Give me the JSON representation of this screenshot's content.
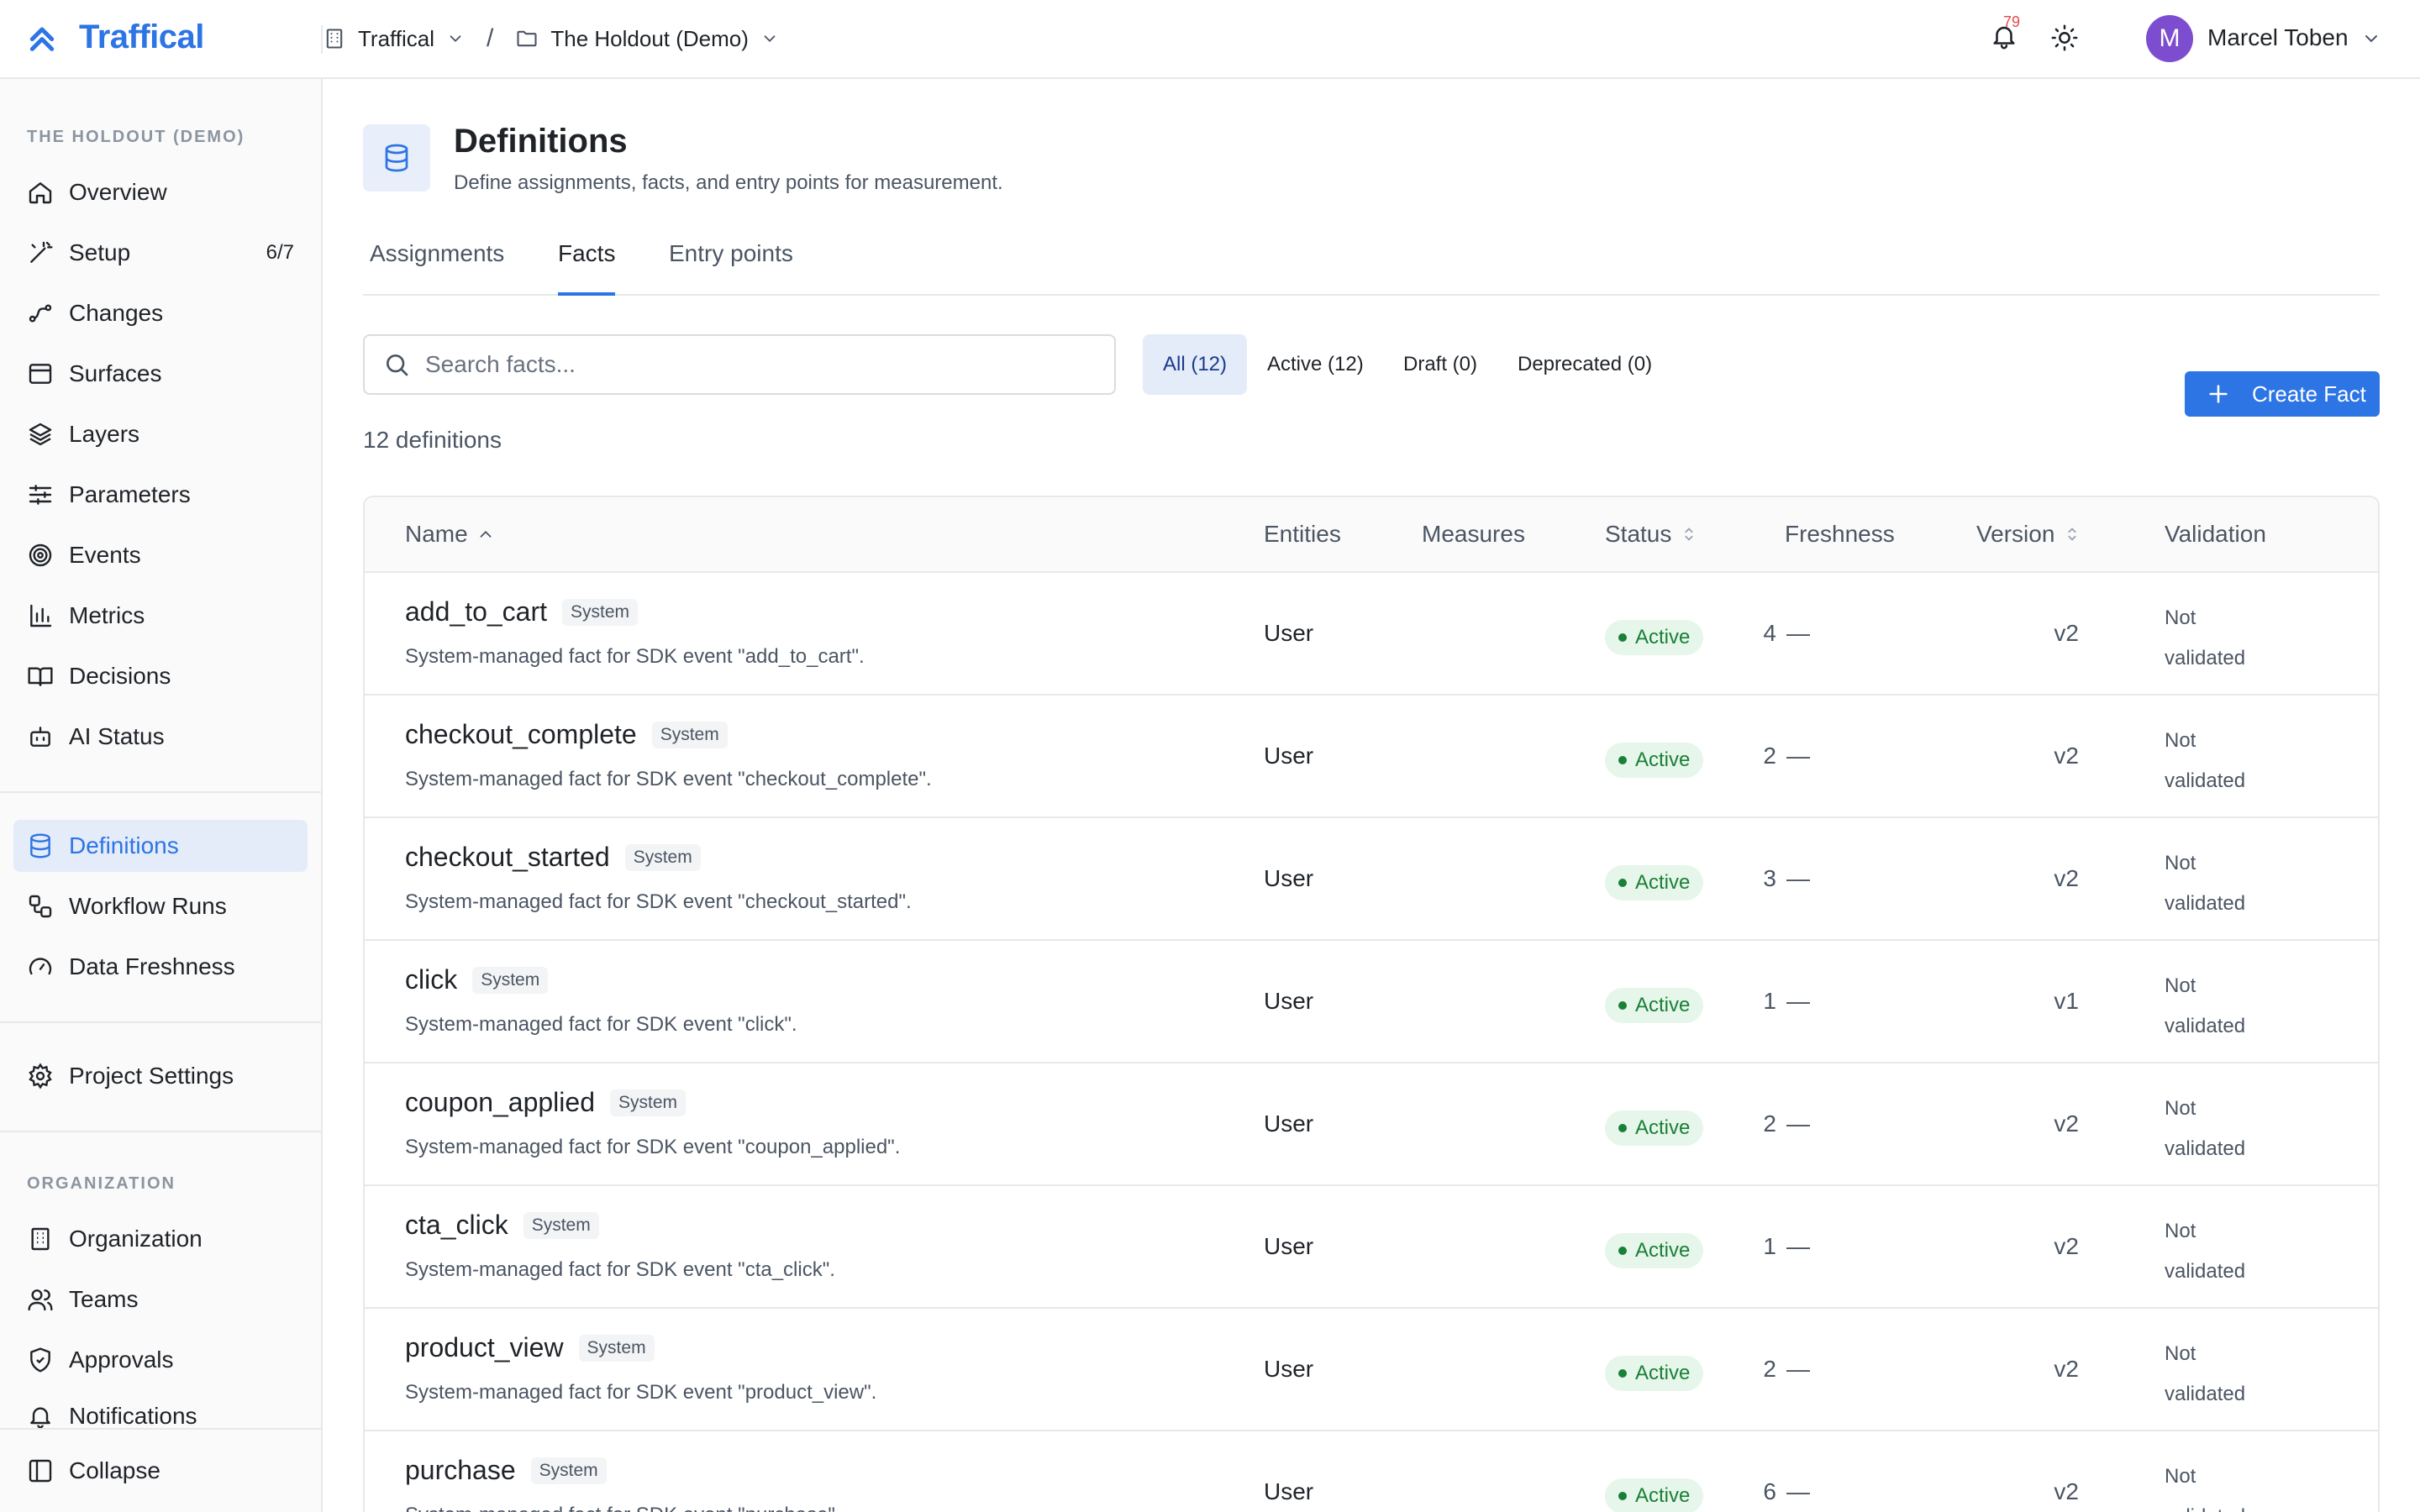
{
  "app": {
    "brand": "Traffical"
  },
  "breadcrumb": {
    "org": "Traffical",
    "separator": "/",
    "project": "The Holdout (Demo)"
  },
  "header": {
    "notification_count": "79",
    "user_initial": "M",
    "user_name": "Marcel Toben"
  },
  "sidebar": {
    "project_section_label": "THE HOLDOUT (DEMO)",
    "items": [
      {
        "label": "Overview",
        "icon": "home-icon"
      },
      {
        "label": "Setup",
        "icon": "wand-icon",
        "count": "6/7"
      },
      {
        "label": "Changes",
        "icon": "waypoints-icon"
      },
      {
        "label": "Surfaces",
        "icon": "browser-icon"
      },
      {
        "label": "Layers",
        "icon": "layers-icon"
      },
      {
        "label": "Parameters",
        "icon": "sliders-icon"
      },
      {
        "label": "Events",
        "icon": "target-icon"
      },
      {
        "label": "Metrics",
        "icon": "bar-chart-icon"
      },
      {
        "label": "Decisions",
        "icon": "book-icon"
      },
      {
        "label": "AI Status",
        "icon": "bot-icon"
      }
    ],
    "definitions_items": [
      {
        "label": "Definitions",
        "icon": "database-icon",
        "active": true
      },
      {
        "label": "Workflow Runs",
        "icon": "workflow-icon"
      },
      {
        "label": "Data Freshness",
        "icon": "gauge-icon"
      }
    ],
    "settings_items": [
      {
        "label": "Project Settings",
        "icon": "gear-icon"
      }
    ],
    "org_section_label": "ORGANIZATION",
    "org_items": [
      {
        "label": "Organization",
        "icon": "building-icon"
      },
      {
        "label": "Teams",
        "icon": "users-icon"
      },
      {
        "label": "Approvals",
        "icon": "shield-check-icon"
      },
      {
        "label": "Notifications",
        "icon": "bell-icon"
      }
    ],
    "collapse_label": "Collapse"
  },
  "page": {
    "title": "Definitions",
    "subtitle": "Define assignments, facts, and entry points for measurement.",
    "tabs": [
      {
        "label": "Assignments"
      },
      {
        "label": "Facts",
        "active": true
      },
      {
        "label": "Entry points"
      }
    ],
    "search_placeholder": "Search facts...",
    "filters": [
      {
        "label": "All (12)",
        "active": true
      },
      {
        "label": "Active (12)"
      },
      {
        "label": "Draft (0)"
      },
      {
        "label": "Deprecated (0)"
      }
    ],
    "create_label": "Create Fact",
    "count_text": "12 definitions"
  },
  "table": {
    "columns": [
      "Name",
      "Entities",
      "Measures",
      "Status",
      "Freshness",
      "Version",
      "Validation"
    ],
    "rows": [
      {
        "name": "add_to_cart",
        "badge": "System",
        "desc": "System-managed fact for SDK event \"add_to_cart\".",
        "entities": "User",
        "measures": "4",
        "status": "Active",
        "freshness": "—",
        "version": "v2",
        "validation_1": "Not",
        "validation_2": "validated"
      },
      {
        "name": "checkout_complete",
        "badge": "System",
        "desc": "System-managed fact for SDK event \"checkout_complete\".",
        "entities": "User",
        "measures": "2",
        "status": "Active",
        "freshness": "—",
        "version": "v2",
        "validation_1": "Not",
        "validation_2": "validated"
      },
      {
        "name": "checkout_started",
        "badge": "System",
        "desc": "System-managed fact for SDK event \"checkout_started\".",
        "entities": "User",
        "measures": "3",
        "status": "Active",
        "freshness": "—",
        "version": "v2",
        "validation_1": "Not",
        "validation_2": "validated"
      },
      {
        "name": "click",
        "badge": "System",
        "desc": "System-managed fact for SDK event \"click\".",
        "entities": "User",
        "measures": "1",
        "status": "Active",
        "freshness": "—",
        "version": "v1",
        "validation_1": "Not",
        "validation_2": "validated"
      },
      {
        "name": "coupon_applied",
        "badge": "System",
        "desc": "System-managed fact for SDK event \"coupon_applied\".",
        "entities": "User",
        "measures": "2",
        "status": "Active",
        "freshness": "—",
        "version": "v2",
        "validation_1": "Not",
        "validation_2": "validated"
      },
      {
        "name": "cta_click",
        "badge": "System",
        "desc": "System-managed fact for SDK event \"cta_click\".",
        "entities": "User",
        "measures": "1",
        "status": "Active",
        "freshness": "—",
        "version": "v2",
        "validation_1": "Not",
        "validation_2": "validated"
      },
      {
        "name": "product_view",
        "badge": "System",
        "desc": "System-managed fact for SDK event \"product_view\".",
        "entities": "User",
        "measures": "2",
        "status": "Active",
        "freshness": "—",
        "version": "v2",
        "validation_1": "Not",
        "validation_2": "validated"
      },
      {
        "name": "purchase",
        "badge": "System",
        "desc": "System-managed fact for SDK event \"purchase\".",
        "entities": "User",
        "measures": "6",
        "status": "Active",
        "freshness": "—",
        "version": "v2",
        "validation_1": "Not",
        "validation_2": "validated"
      }
    ]
  },
  "colors": {
    "accent": "#2d74e5",
    "active_green": "#1a7f37",
    "avatar": "#7c4dce"
  }
}
